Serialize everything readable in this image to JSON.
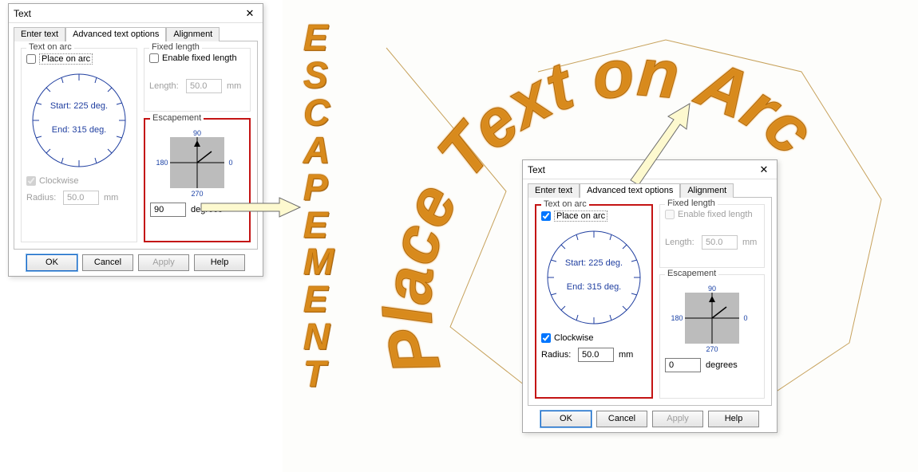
{
  "dialog1": {
    "title": "Text",
    "tabs": [
      "Enter text",
      "Advanced text options",
      "Alignment"
    ],
    "groups": {
      "arc_title": "Text on arc",
      "place_on_arc": "Place on arc",
      "place_checked": false,
      "start": "Start: 225 deg.",
      "end": "End: 315 deg.",
      "clockwise": "Clockwise",
      "clockwise_checked": true,
      "radius_label": "Radius:",
      "radius_val": "50.0",
      "radius_unit": "mm",
      "fixed_title": "Fixed length",
      "fixed_label": "Enable fixed length",
      "fixed_checked": false,
      "length_label": "Length:",
      "length_val": "50.0",
      "length_unit": "mm",
      "esc_title": "Escapement",
      "esc_val": "90",
      "esc_unit": "degrees",
      "esc_ticks": {
        "top": "90",
        "right": "0",
        "left": "180",
        "bottom": "270"
      }
    },
    "buttons": {
      "ok": "OK",
      "cancel": "Cancel",
      "apply": "Apply",
      "help": "Help"
    }
  },
  "dialog2": {
    "title": "Text",
    "tabs": [
      "Enter text",
      "Advanced text options",
      "Alignment"
    ],
    "groups": {
      "arc_title": "Text on arc",
      "place_on_arc": "Place on arc",
      "place_checked": true,
      "start": "Start: 225 deg.",
      "end": "End: 315 deg.",
      "clockwise": "Clockwise",
      "clockwise_checked": true,
      "radius_label": "Radius:",
      "radius_val": "50.0",
      "radius_unit": "mm",
      "fixed_title": "Fixed length",
      "fixed_label": "Enable fixed length",
      "fixed_checked": false,
      "length_label": "Length:",
      "length_val": "50.0",
      "length_unit": "mm",
      "esc_title": "Escapement",
      "esc_val": "0",
      "esc_unit": "degrees",
      "esc_ticks": {
        "top": "90",
        "right": "0",
        "left": "180",
        "bottom": "270"
      }
    },
    "buttons": {
      "ok": "OK",
      "cancel": "Cancel",
      "apply": "Apply",
      "help": "Help"
    }
  },
  "emb_vertical": "ESCAPEMENT",
  "emb_arc": "Place Text on Arc"
}
